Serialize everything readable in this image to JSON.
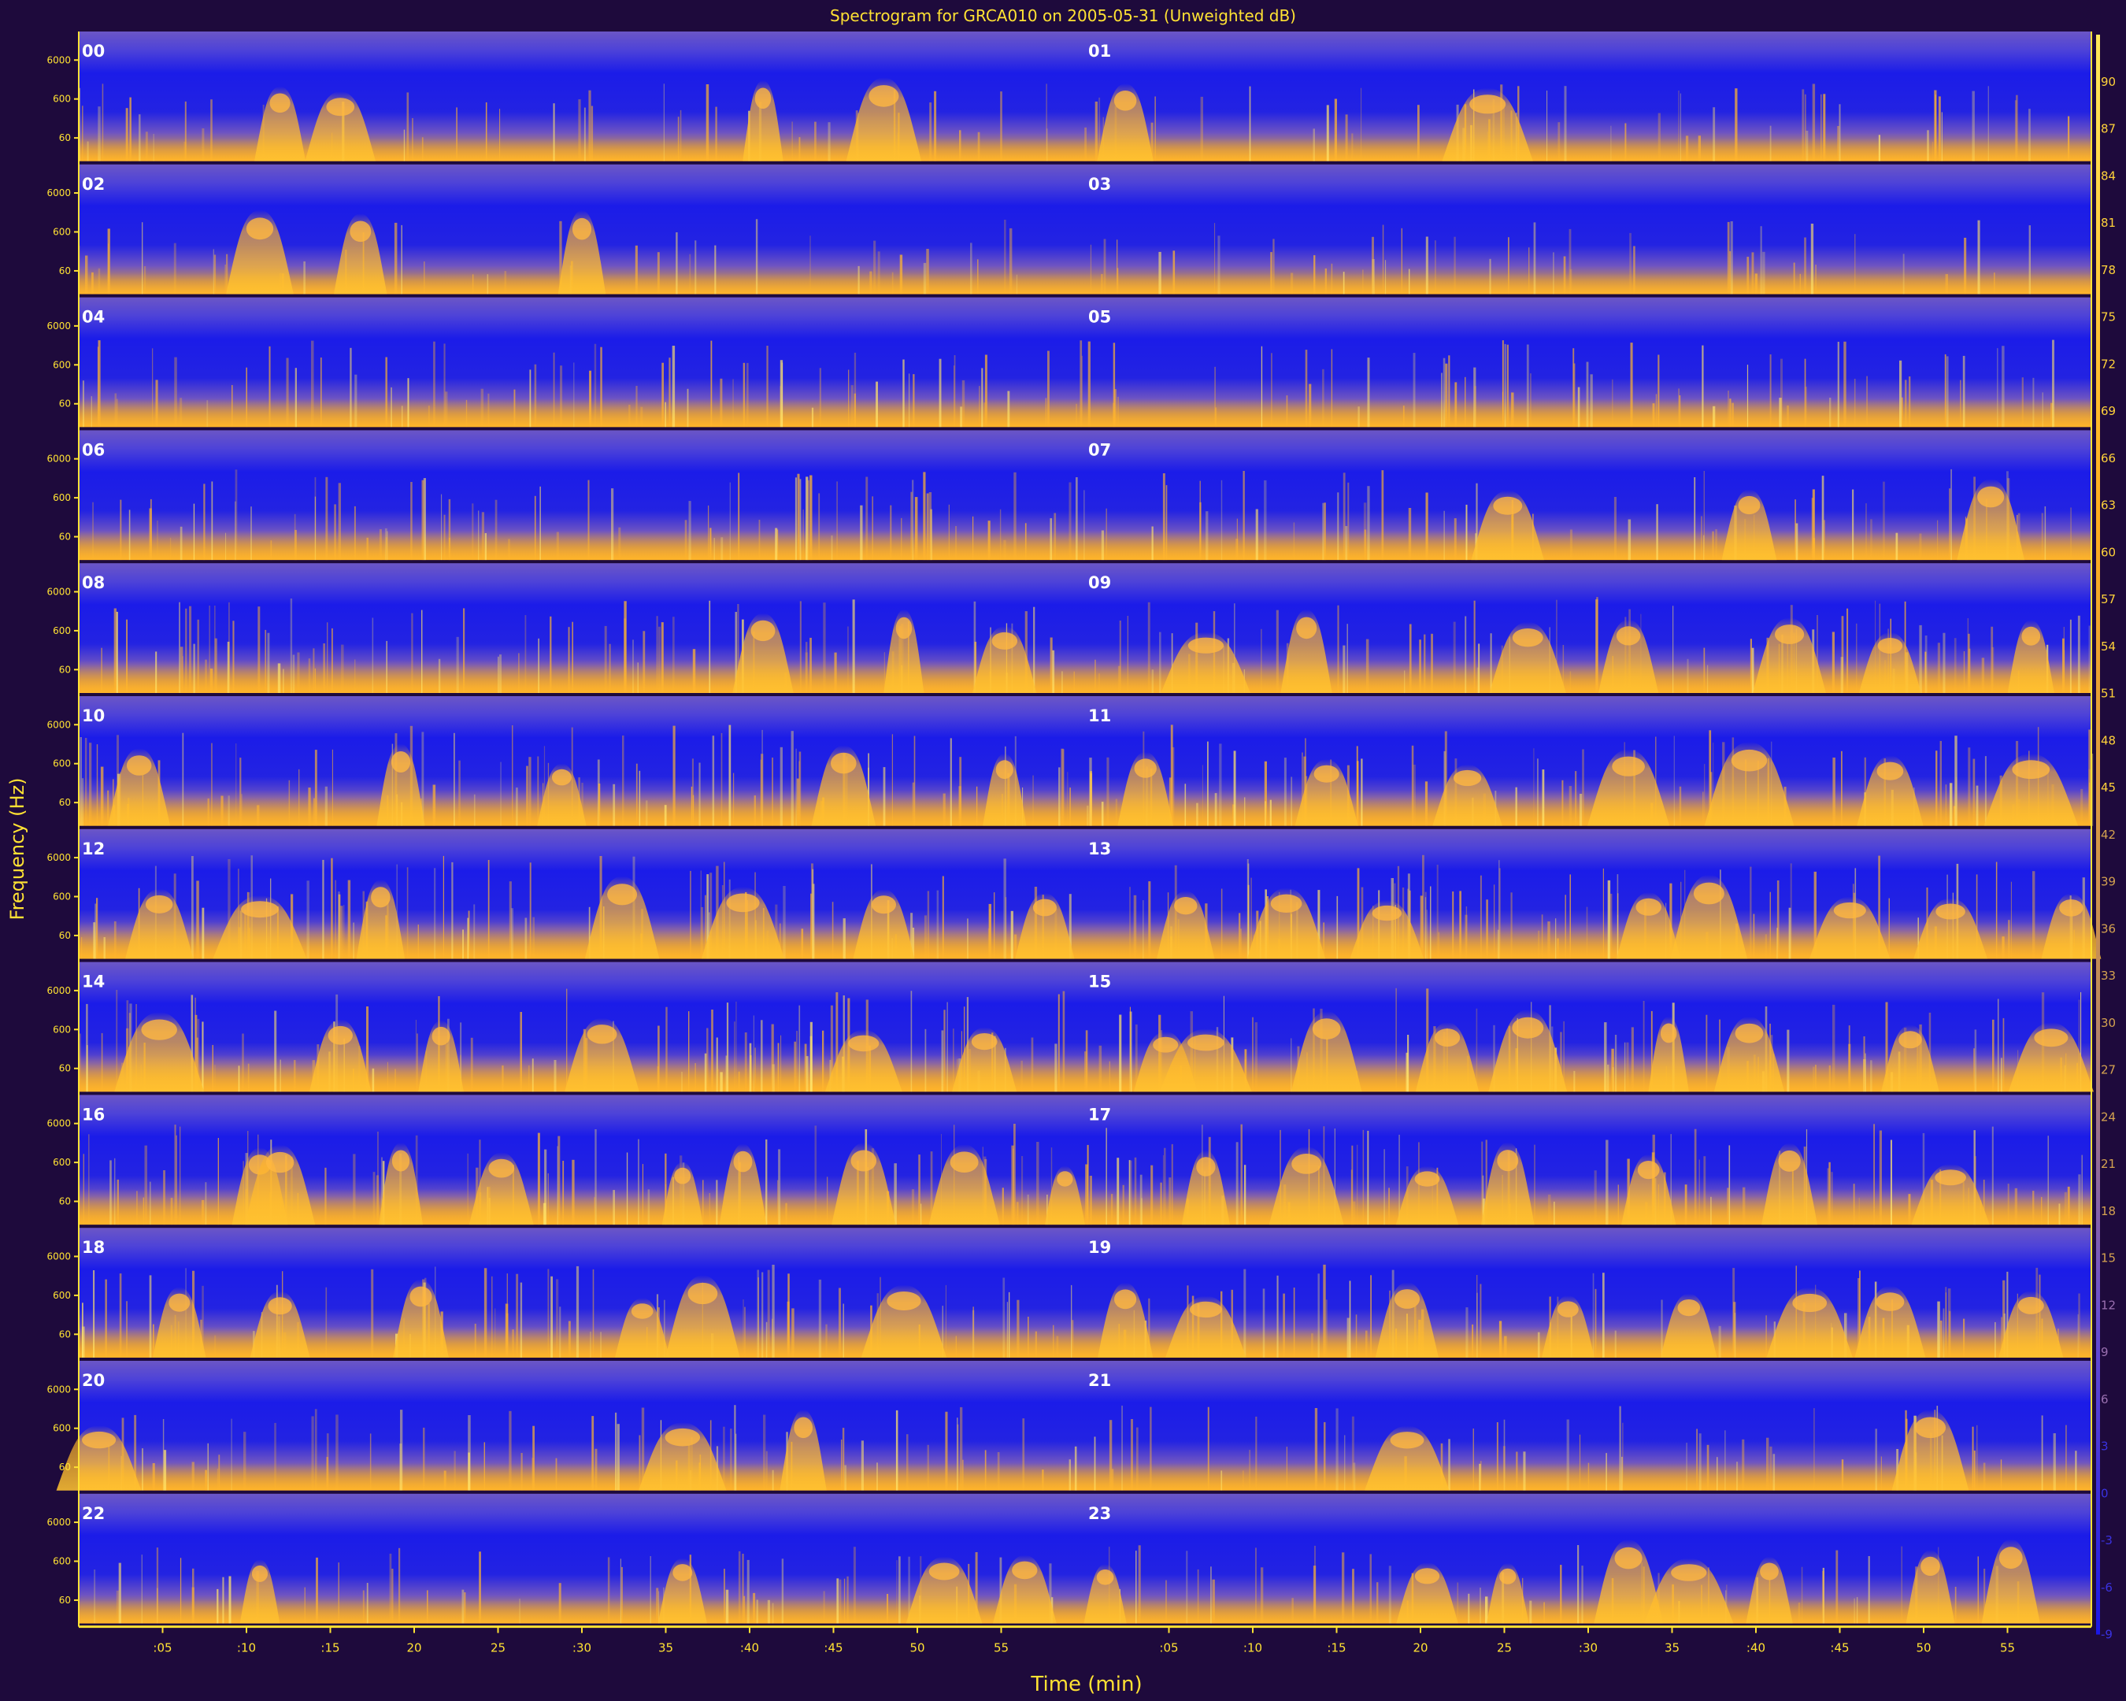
{
  "chart_data": {
    "type": "heatmap",
    "title": "Spectrogram for GRCA010 on 2005-05-31 (Unweighted dB)",
    "xlabel": "Time (min)",
    "ylabel": "Frequency (Hz)",
    "x_tick_labels": [
      ":05",
      ":10",
      ":15",
      "20",
      "25",
      ":30",
      "35",
      ":40",
      ":45",
      "50",
      "55"
    ],
    "y_tick_labels": [
      "6000",
      "600",
      "60"
    ],
    "colorbar": {
      "ticks": [
        90,
        87,
        84,
        81,
        78,
        75,
        72,
        69,
        66,
        63,
        60,
        57,
        54,
        51,
        48,
        45,
        42,
        39,
        36,
        33,
        30,
        27,
        24,
        21,
        18,
        15,
        12,
        9,
        6,
        3,
        0,
        -3,
        -6,
        -9
      ],
      "range": [
        -9,
        93
      ],
      "colors": [
        "#1a18e6",
        "#6a4fd0",
        "#c08a5a",
        "#ffae1e",
        "#ffe95a"
      ]
    },
    "hour_labels": [
      "00",
      "01",
      "02",
      "03",
      "04",
      "05",
      "06",
      "07",
      "08",
      "09",
      "10",
      "11",
      "12",
      "13",
      "14",
      "15",
      "16",
      "17",
      "18",
      "19",
      "20",
      "21",
      "22",
      "23"
    ],
    "rows": [
      {
        "hours": [
          "00",
          "01"
        ],
        "activity": 0.25,
        "bursts": [
          0.1,
          0.13,
          0.34,
          0.4,
          0.52,
          0.7
        ]
      },
      {
        "hours": [
          "02",
          "03"
        ],
        "activity": 0.2,
        "bursts": [
          0.09,
          0.14,
          0.25
        ]
      },
      {
        "hours": [
          "04",
          "05"
        ],
        "activity": 0.45,
        "bursts": []
      },
      {
        "hours": [
          "06",
          "07"
        ],
        "activity": 0.5,
        "bursts": [
          0.71,
          0.83,
          0.95
        ]
      },
      {
        "hours": [
          "08",
          "09"
        ],
        "activity": 0.6,
        "bursts": [
          0.34,
          0.41,
          0.46,
          0.56,
          0.61,
          0.72,
          0.77,
          0.85,
          0.9,
          0.97
        ]
      },
      {
        "hours": [
          "10",
          "11"
        ],
        "activity": 0.7,
        "bursts": [
          0.03,
          0.16,
          0.24,
          0.38,
          0.46,
          0.53,
          0.62,
          0.69,
          0.77,
          0.83,
          0.9,
          0.97
        ]
      },
      {
        "hours": [
          "12",
          "13"
        ],
        "activity": 0.75,
        "bursts": [
          0.04,
          0.09,
          0.15,
          0.27,
          0.33,
          0.4,
          0.48,
          0.55,
          0.6,
          0.65,
          0.78,
          0.81,
          0.88,
          0.93,
          0.99
        ]
      },
      {
        "hours": [
          "14",
          "15"
        ],
        "activity": 0.75,
        "bursts": [
          0.04,
          0.13,
          0.18,
          0.26,
          0.39,
          0.45,
          0.54,
          0.56,
          0.62,
          0.68,
          0.72,
          0.79,
          0.83,
          0.91,
          0.98
        ]
      },
      {
        "hours": [
          "16",
          "17"
        ],
        "activity": 0.7,
        "bursts": [
          0.09,
          0.1,
          0.16,
          0.21,
          0.3,
          0.33,
          0.39,
          0.44,
          0.49,
          0.56,
          0.61,
          0.67,
          0.71,
          0.78,
          0.85,
          0.93
        ]
      },
      {
        "hours": [
          "18",
          "19"
        ],
        "activity": 0.55,
        "bursts": [
          0.05,
          0.1,
          0.17,
          0.28,
          0.31,
          0.41,
          0.52,
          0.56,
          0.66,
          0.74,
          0.8,
          0.86,
          0.9,
          0.97
        ]
      },
      {
        "hours": [
          "20",
          "21"
        ],
        "activity": 0.4,
        "bursts": [
          0.01,
          0.3,
          0.36,
          0.66,
          0.92
        ]
      },
      {
        "hours": [
          "22",
          "23"
        ],
        "activity": 0.3,
        "bursts": [
          0.09,
          0.3,
          0.43,
          0.47,
          0.51,
          0.67,
          0.71,
          0.77,
          0.8,
          0.84,
          0.92,
          0.96
        ]
      }
    ]
  }
}
